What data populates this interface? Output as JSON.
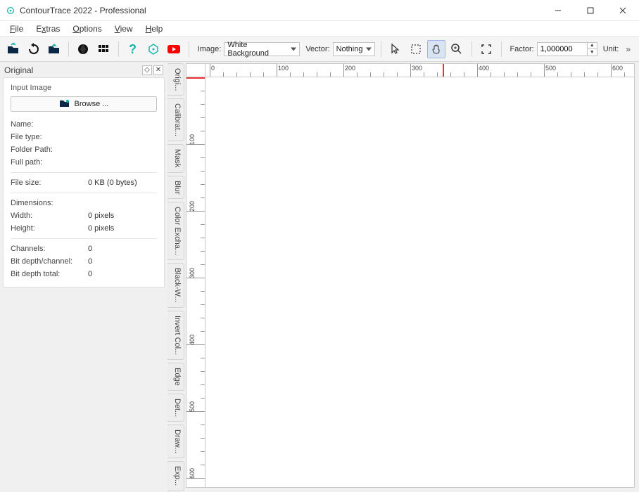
{
  "window": {
    "title": "ContourTrace 2022 - Professional"
  },
  "menu": {
    "file": "File",
    "extras": "Extras",
    "options": "Options",
    "view": "View",
    "help": "Help"
  },
  "toolbar": {
    "image_label": "Image:",
    "image_value": "White Background",
    "vector_label": "Vector:",
    "vector_value": "Nothing",
    "factor_label": "Factor:",
    "factor_value": "1,000000",
    "unit_label": "Unit:"
  },
  "side": {
    "panel_title": "Original",
    "group_title": "Input Image",
    "browse_label": "Browse ...",
    "rows": {
      "name": {
        "label": "Name:",
        "value": ""
      },
      "file_type": {
        "label": "File type:",
        "value": ""
      },
      "folder_path": {
        "label": "Folder Path:",
        "value": ""
      },
      "full_path": {
        "label": "Full path:",
        "value": ""
      },
      "file_size": {
        "label": "File size:",
        "value": "0 KB (0 bytes)"
      },
      "dimensions": {
        "label": "Dimensions:",
        "value": ""
      },
      "width": {
        "label": "Width:",
        "value": "0 pixels"
      },
      "height": {
        "label": "Height:",
        "value": "0 pixels"
      },
      "channels": {
        "label": "Channels:",
        "value": "0"
      },
      "bit_depth_channel": {
        "label": "Bit depth/channel:",
        "value": "0"
      },
      "bit_depth_total": {
        "label": "Bit depth total:",
        "value": "0"
      }
    }
  },
  "vertical_tabs": [
    "Origi...",
    "Calibrat...",
    "Mask",
    "Blur",
    "Color Excha...",
    "Black-W...",
    "Invert Col...",
    "Edge",
    "Det...",
    "Draw...",
    "Exp..."
  ],
  "ruler": {
    "h_ticks": [
      0,
      100,
      200,
      300,
      400,
      500,
      600
    ],
    "v_ticks": [
      100,
      200,
      300,
      400,
      500,
      600
    ],
    "h_marker": 348
  }
}
